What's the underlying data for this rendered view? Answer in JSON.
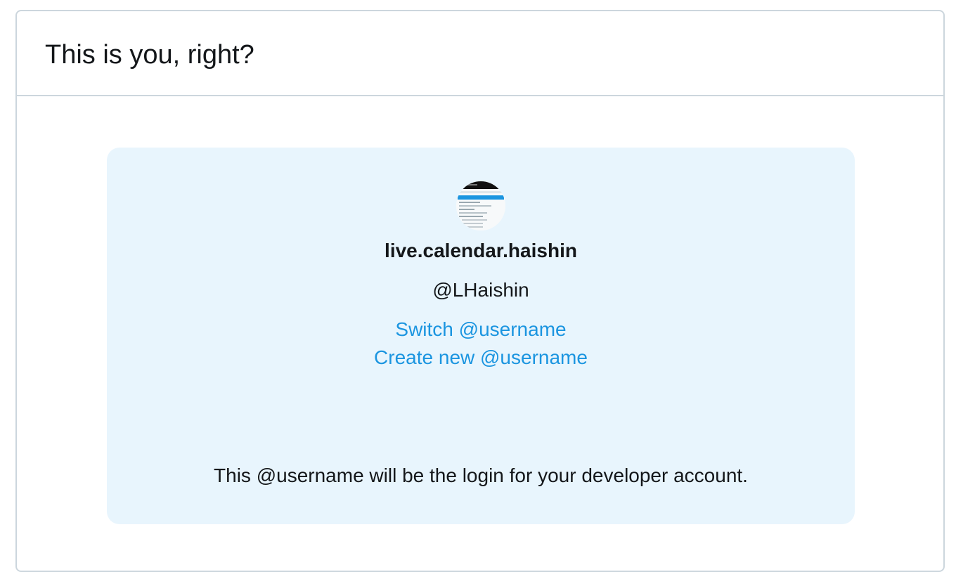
{
  "header": {
    "title": "This is you, right?"
  },
  "profile": {
    "avatar_icon": "avatar-screenshot-thumbnail",
    "display_name": "live.calendar.haishin",
    "handle": "@LHaishin",
    "switch_link": "Switch @username",
    "create_link": "Create new @username",
    "note": "This @username will be the login for your developer account."
  },
  "colors": {
    "link": "#1b95e0",
    "panel_background": "#e8f5fd",
    "border": "#ccd6dd",
    "text": "#14171a"
  }
}
